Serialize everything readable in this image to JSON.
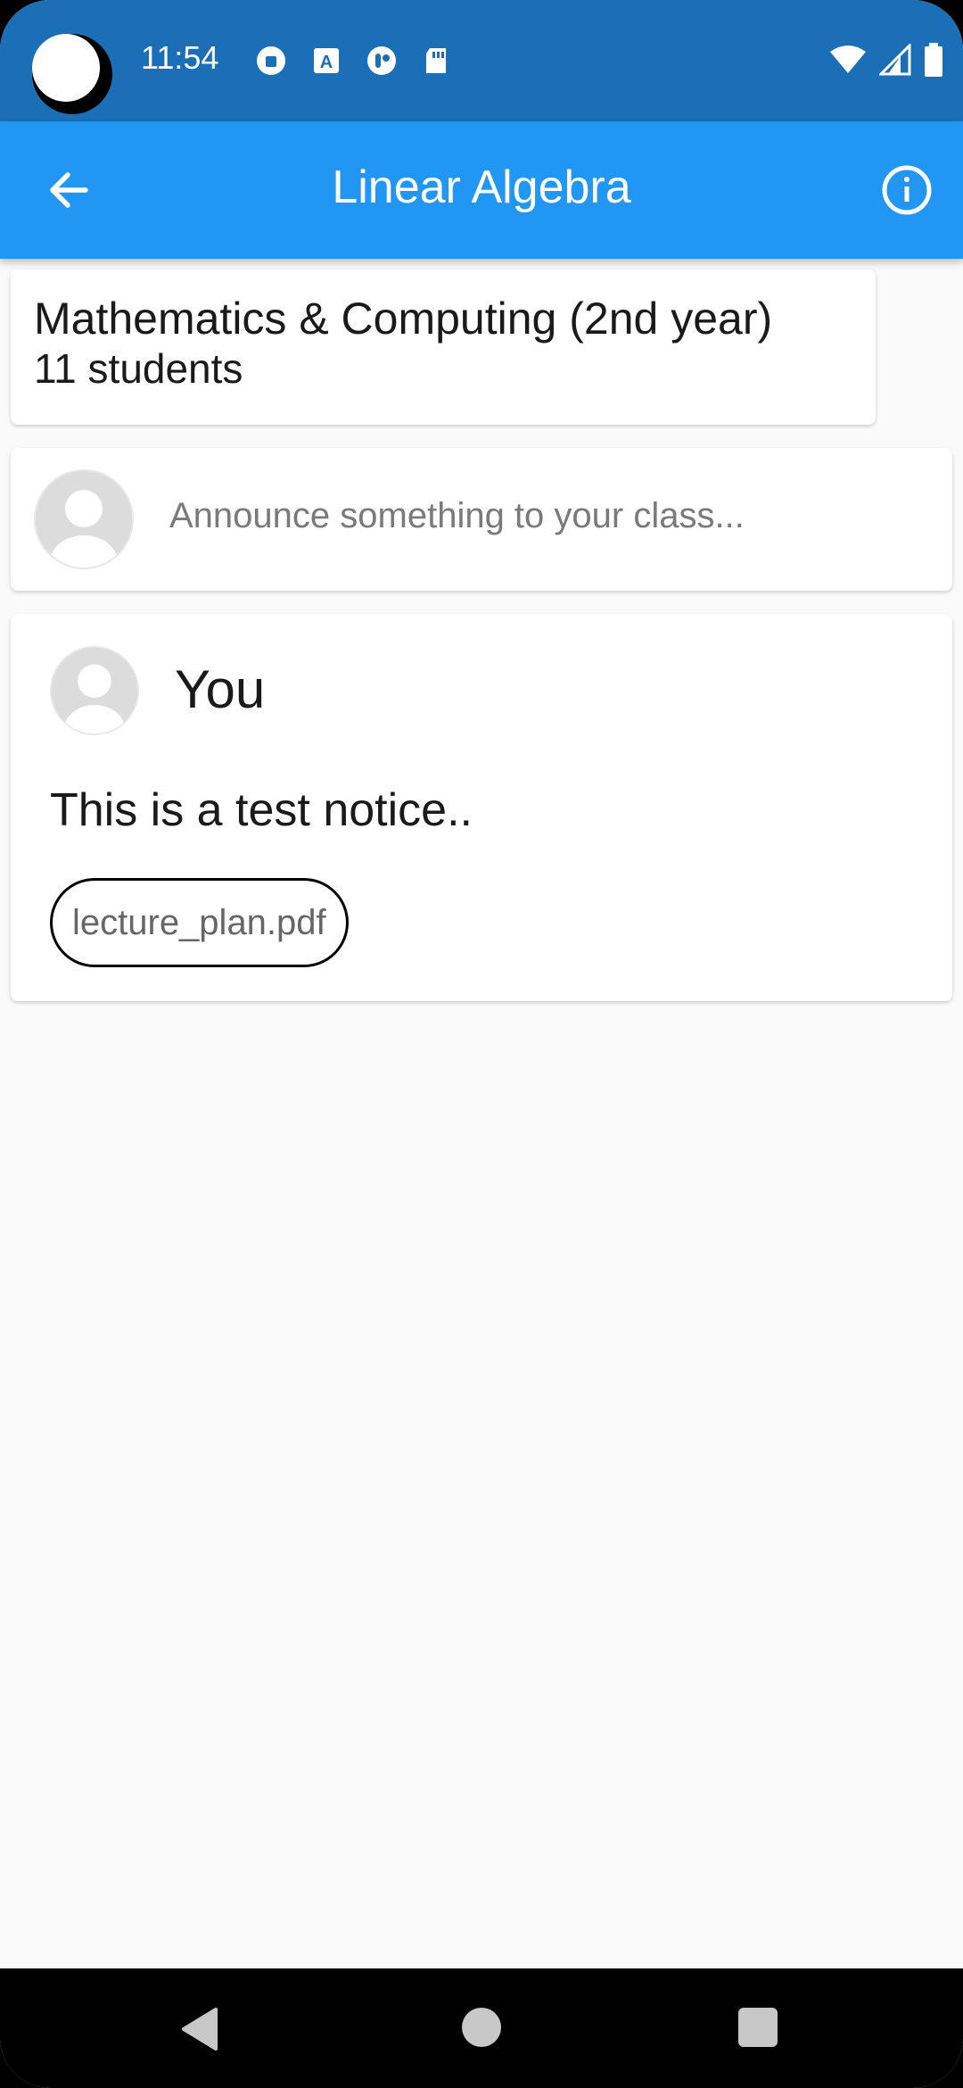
{
  "status_bar": {
    "time": "11:54",
    "icons": [
      "vpn-icon",
      "text-a-icon",
      "toggle-icon",
      "sd-card-icon"
    ],
    "right_icons": [
      "wifi-icon",
      "signal-icon",
      "battery-icon"
    ]
  },
  "app_bar": {
    "title": "Linear Algebra",
    "back_icon": "arrow-left-icon",
    "info_icon": "info-icon"
  },
  "class_info": {
    "name": "Mathematics & Computing (2nd year)",
    "students": "11 students"
  },
  "announce": {
    "placeholder": "Announce something to your class..."
  },
  "post": {
    "author": "You",
    "body": "This is a test notice..",
    "attachment": "lecture_plan.pdf"
  },
  "colors": {
    "status_bar": "#1b6fb6",
    "app_bar": "#2196f3",
    "background": "#fafafa"
  }
}
